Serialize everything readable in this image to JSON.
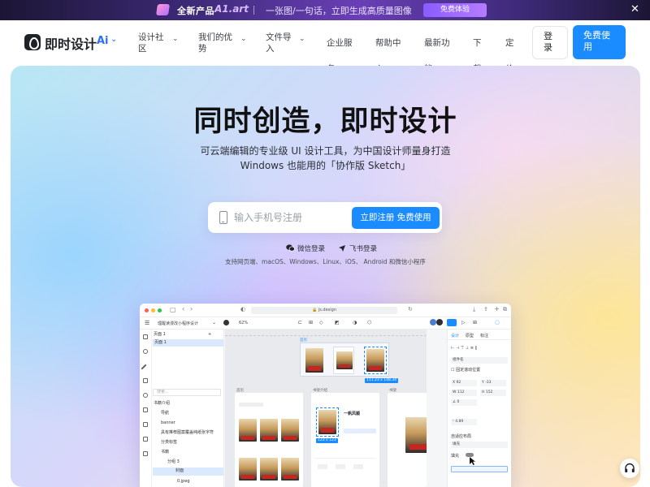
{
  "promo": {
    "label": "全新产品",
    "product": "A1.art",
    "tagline": "一张图/一句话，立即生成高质量图像",
    "cta": "免费体验",
    "close": "✕"
  },
  "nav": {
    "logo_text": "即时设计",
    "ai_badge": "Ai",
    "items": [
      {
        "line1": "设计社",
        "line2": "区"
      },
      {
        "line1": "我们的优",
        "line2": "势"
      },
      {
        "line1": "文件导",
        "line2": "入"
      },
      {
        "line1": "企业服",
        "line2": "务"
      },
      {
        "line1": "帮助中",
        "line2": "心"
      },
      {
        "line1": "最新功",
        "line2": "能"
      },
      {
        "line1": "下",
        "line2": "载"
      },
      {
        "line1": "定",
        "line2": "价"
      }
    ],
    "login": {
      "line1": "登",
      "line2": "录"
    },
    "free": {
      "line1": "免费使",
      "line2": "用"
    }
  },
  "hero": {
    "title": "同时创造，即时设计",
    "subtitle_line1": "可云端编辑的专业级 UI 设计工具，为中国设计师量身打造",
    "subtitle_line2": "Windows 也能用的「协作版 Sketch」",
    "phone_placeholder": "输入手机号注册",
    "register_button": "立即注册 免费使用",
    "wechat_login": "微信登录",
    "feishu_login": "飞书登录",
    "platforms": "支持网页端、macOS、Windows、Linux、iOS、 Android 和微信小程序"
  },
  "app": {
    "url": "js.design",
    "file_name": "理醒读漫改小程序设计",
    "zoom": "62%",
    "page_label": "页面 1",
    "search_placeholder": "搜索...",
    "layers": [
      "书籍介绍",
      "导航",
      "banner",
      "具有推荐图案覆盖纯纸张字符",
      "分类标签",
      "书籍",
      "分组 3",
      "封面",
      "0.jpeg"
    ],
    "canvas_labels": [
      "首页",
      "书架介绍",
      "书架",
      "123 x 123"
    ],
    "size_tag": "111.23 x 148.34",
    "book_title": "一帆风顺",
    "right_tabs": [
      "设计",
      "原型",
      "标注"
    ],
    "props": {
      "x": "92",
      "y": "-33",
      "w": "112",
      "h": "152",
      "rotation": "0",
      "radius": "4.89"
    },
    "fill_label": "填充",
    "auto_label": "自适应布局",
    "sticky_label": "固定滚动位置",
    "component_label": "组件名",
    "fit_label": "填充"
  }
}
